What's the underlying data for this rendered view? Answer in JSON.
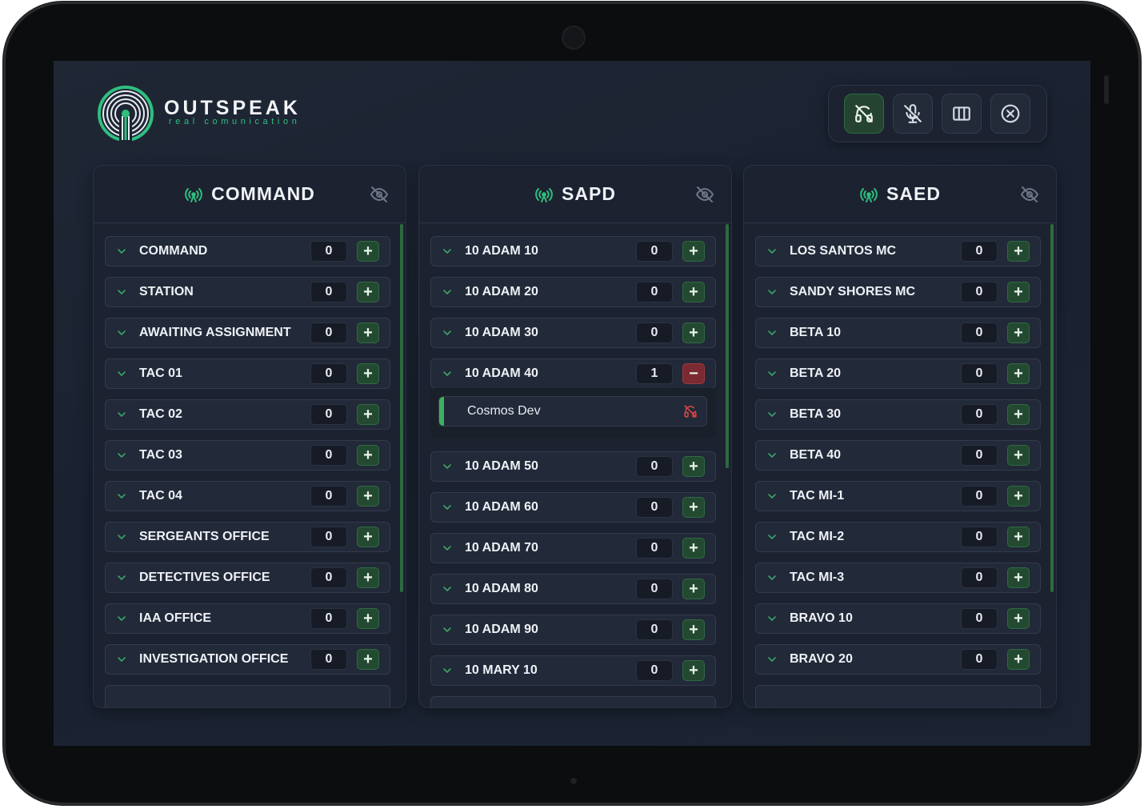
{
  "app": {
    "name": "OUTSPEAK",
    "tagline": "real comunication"
  },
  "toolbar": {
    "buttons": [
      {
        "name": "headset-off",
        "icon": "headset-off-icon",
        "active": true
      },
      {
        "name": "mic-off",
        "icon": "mic-off-icon",
        "active": false
      },
      {
        "name": "columns",
        "icon": "columns-icon",
        "active": false
      },
      {
        "name": "close",
        "icon": "close-circle-icon",
        "active": false
      }
    ]
  },
  "columns": [
    {
      "title": "COMMAND",
      "channels": [
        {
          "label": "COMMAND",
          "count": "0",
          "action": "+"
        },
        {
          "label": "STATION",
          "count": "0",
          "action": "+"
        },
        {
          "label": "AWAITING ASSIGNMENT",
          "count": "0",
          "action": "+"
        },
        {
          "label": "TAC 01",
          "count": "0",
          "action": "+"
        },
        {
          "label": "TAC 02",
          "count": "0",
          "action": "+"
        },
        {
          "label": "TAC 03",
          "count": "0",
          "action": "+"
        },
        {
          "label": "TAC 04",
          "count": "0",
          "action": "+"
        },
        {
          "label": "SERGEANTS OFFICE",
          "count": "0",
          "action": "+"
        },
        {
          "label": "DETECTIVES OFFICE",
          "count": "0",
          "action": "+"
        },
        {
          "label": "IAA OFFICE",
          "count": "0",
          "action": "+"
        },
        {
          "label": "INVESTIGATION OFFICE",
          "count": "0",
          "action": "+"
        }
      ]
    },
    {
      "title": "SAPD",
      "channels": [
        {
          "label": "10 ADAM 10",
          "count": "0",
          "action": "+"
        },
        {
          "label": "10 ADAM 20",
          "count": "0",
          "action": "+"
        },
        {
          "label": "10 ADAM 30",
          "count": "0",
          "action": "+"
        },
        {
          "label": "10 ADAM 40",
          "count": "1",
          "action": "−",
          "members": [
            "Cosmos Dev"
          ]
        },
        {
          "label": "10 ADAM 50",
          "count": "0",
          "action": "+"
        },
        {
          "label": "10 ADAM 60",
          "count": "0",
          "action": "+"
        },
        {
          "label": "10 ADAM 70",
          "count": "0",
          "action": "+"
        },
        {
          "label": "10 ADAM 80",
          "count": "0",
          "action": "+"
        },
        {
          "label": "10 ADAM 90",
          "count": "0",
          "action": "+"
        },
        {
          "label": "10 MARY 10",
          "count": "0",
          "action": "+"
        }
      ]
    },
    {
      "title": "SAED",
      "channels": [
        {
          "label": "LOS SANTOS MC",
          "count": "0",
          "action": "+"
        },
        {
          "label": "SANDY SHORES MC",
          "count": "0",
          "action": "+"
        },
        {
          "label": "BETA 10",
          "count": "0",
          "action": "+"
        },
        {
          "label": "BETA 20",
          "count": "0",
          "action": "+"
        },
        {
          "label": "BETA 30",
          "count": "0",
          "action": "+"
        },
        {
          "label": "BETA 40",
          "count": "0",
          "action": "+"
        },
        {
          "label": "TAC MI-1",
          "count": "0",
          "action": "+"
        },
        {
          "label": "TAC MI-2",
          "count": "0",
          "action": "+"
        },
        {
          "label": "TAC MI-3",
          "count": "0",
          "action": "+"
        },
        {
          "label": "BRAVO 10",
          "count": "0",
          "action": "+"
        },
        {
          "label": "BRAVO 20",
          "count": "0",
          "action": "+"
        }
      ]
    }
  ],
  "colors": {
    "accent": "#2fbf7f",
    "add": "#234a31",
    "remove": "#7a2a30",
    "member_bar": "#3bb35e"
  }
}
